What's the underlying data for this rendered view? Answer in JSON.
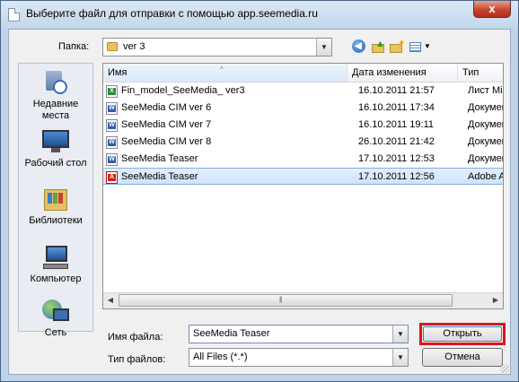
{
  "window": {
    "title": "Выберите файл для отправки с помощью app.seemedia.ru",
    "close_label": "x"
  },
  "toolbar": {
    "folder_label": "Папка:",
    "folder_value": "ver 3"
  },
  "places": [
    {
      "label": "Недавние места"
    },
    {
      "label": "Рабочий стол"
    },
    {
      "label": "Библиотеки"
    },
    {
      "label": "Компьютер"
    },
    {
      "label": "Сеть"
    }
  ],
  "file_list": {
    "columns": [
      "Имя",
      "Дата изменения",
      "Тип"
    ],
    "rows": [
      {
        "icon": "excel-file-icon",
        "name": "Fin_model_SeeMedia_ ver3",
        "date": "16.10.2011 21:57",
        "type": "Лист Micr",
        "selected": false
      },
      {
        "icon": "word-file-icon",
        "name": "SeeMedia CIM ver 6",
        "date": "16.10.2011 17:34",
        "type": "Докумен",
        "selected": false
      },
      {
        "icon": "word-file-icon",
        "name": "SeeMedia CIM ver 7",
        "date": "16.10.2011 19:11",
        "type": "Докумен",
        "selected": false
      },
      {
        "icon": "word-file-icon",
        "name": "SeeMedia CIM ver 8",
        "date": "26.10.2011 21:42",
        "type": "Докумен",
        "selected": false
      },
      {
        "icon": "word-file-icon",
        "name": "SeeMedia Teaser",
        "date": "17.10.2011 12:53",
        "type": "Докумен",
        "selected": false
      },
      {
        "icon": "pdf-file-icon",
        "name": "SeeMedia Teaser",
        "date": "17.10.2011 12:56",
        "type": "Adobe Ac",
        "selected": true
      }
    ]
  },
  "footer": {
    "filename_label": "Имя файла:",
    "filename_value": "SeeMedia Teaser",
    "filetype_label": "Тип файлов:",
    "filetype_value": "All Files (*.*)",
    "open_label": "Открыть",
    "cancel_label": "Отмена"
  },
  "colors": {
    "accent_highlight": "#d8161b",
    "selection": "#cfe3fb",
    "titlebar": "#c4d7ec"
  }
}
